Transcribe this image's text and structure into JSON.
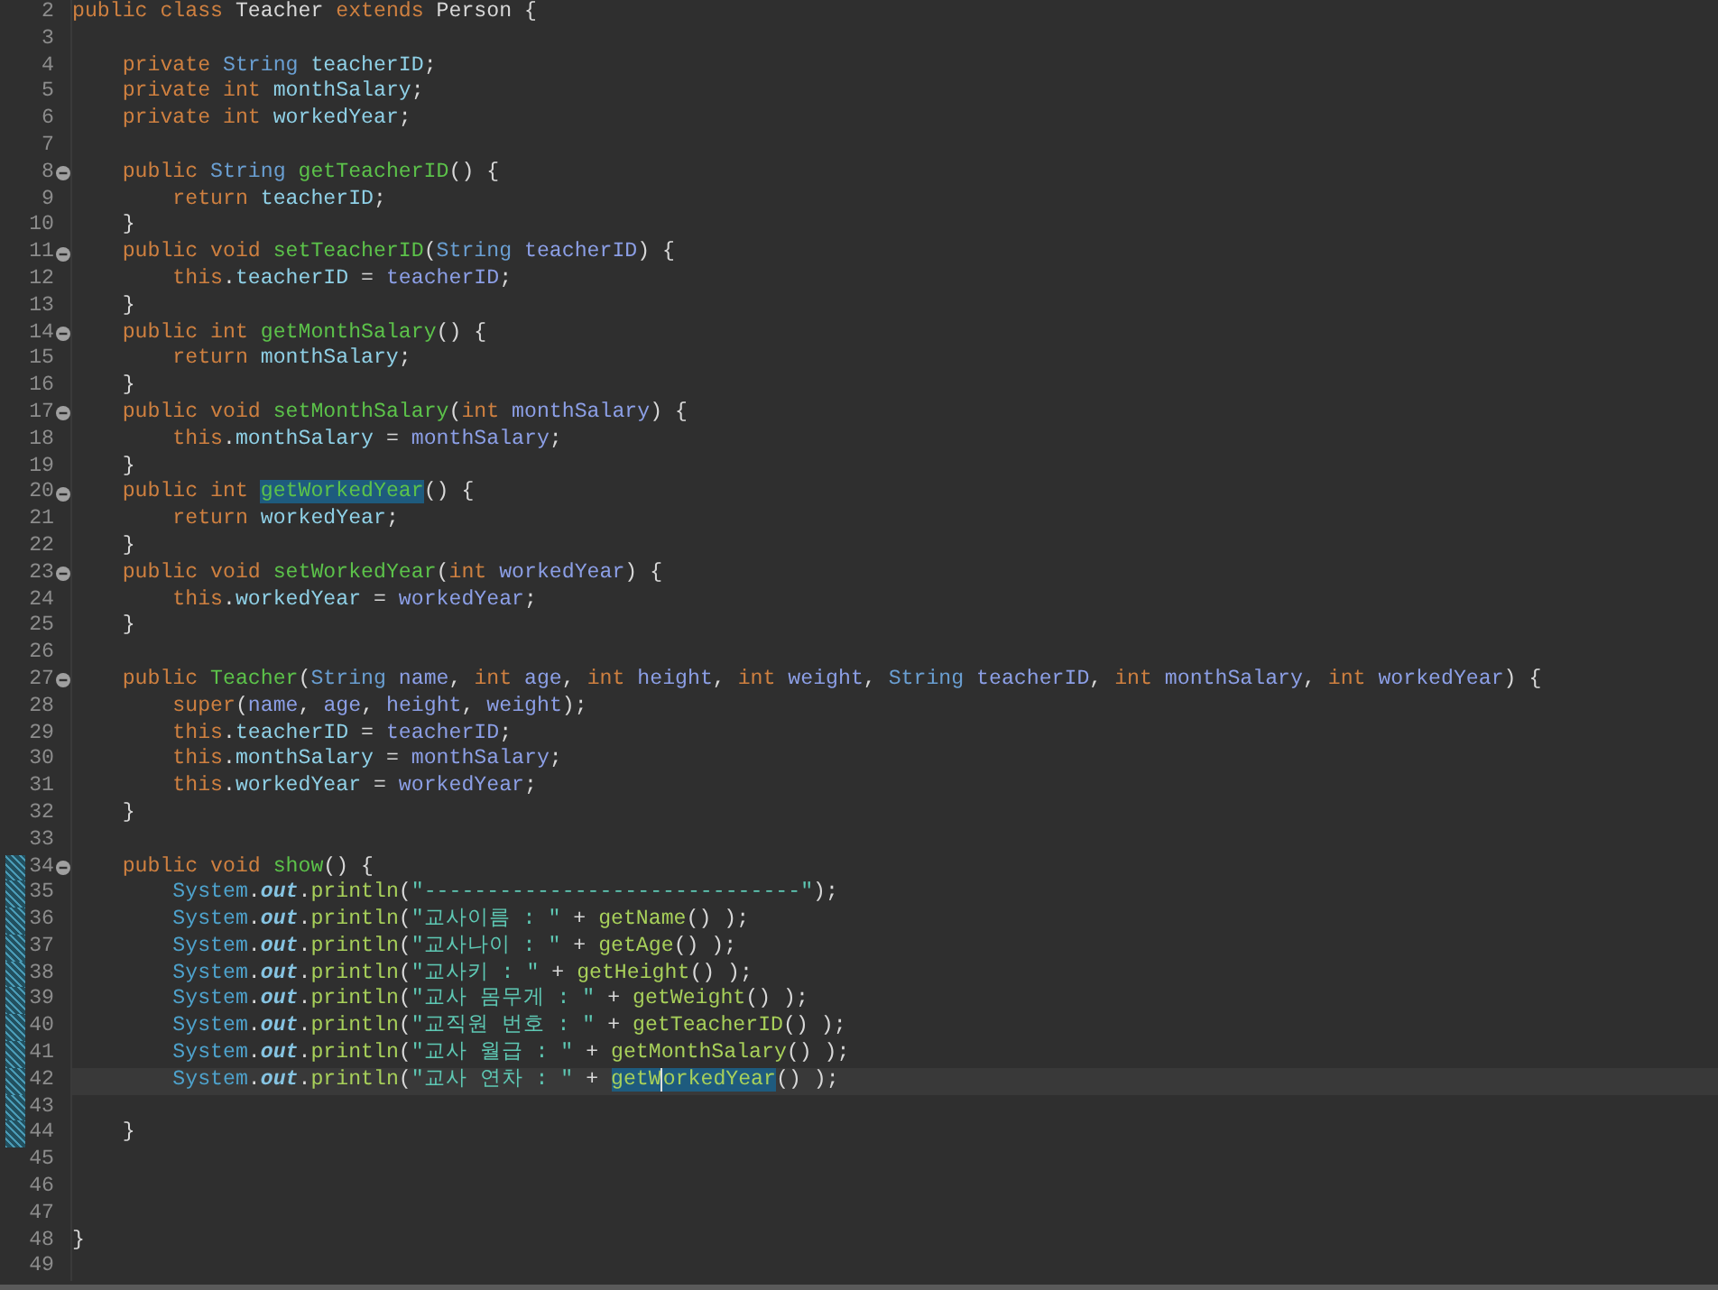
{
  "editor": {
    "lines": [
      {
        "number": "2",
        "fold": false,
        "changed": false,
        "current": false,
        "tokens": [
          {
            "kind": "keyword",
            "text": "public"
          },
          {
            "kind": "keyword",
            "text": " class"
          },
          {
            "kind": "plain",
            "text": " Teacher"
          },
          {
            "kind": "keyword",
            "text": " extends"
          },
          {
            "kind": "plain",
            "text": " Person {"
          }
        ]
      },
      {
        "number": "3",
        "fold": false,
        "changed": false,
        "current": false
      },
      {
        "number": "4",
        "fold": false,
        "changed": false,
        "current": false,
        "tokens": [
          {
            "kind": "keyword",
            "text": "    private"
          },
          {
            "kind": "type",
            "text": " String"
          },
          {
            "kind": "field",
            "text": " teacherID"
          },
          {
            "kind": "plain",
            "text": ";"
          }
        ]
      },
      {
        "number": "5",
        "fold": false,
        "changed": false,
        "current": false,
        "tokens": [
          {
            "kind": "keyword",
            "text": "    private"
          },
          {
            "kind": "keyword",
            "text": " int"
          },
          {
            "kind": "field",
            "text": " monthSalary"
          },
          {
            "kind": "plain",
            "text": ";"
          }
        ]
      },
      {
        "number": "6",
        "fold": false,
        "changed": false,
        "current": false,
        "tokens": [
          {
            "kind": "keyword",
            "text": "    private"
          },
          {
            "kind": "keyword",
            "text": " int"
          },
          {
            "kind": "field",
            "text": " workedYear"
          },
          {
            "kind": "plain",
            "text": ";"
          }
        ]
      },
      {
        "number": "7",
        "fold": false,
        "changed": false,
        "current": false
      },
      {
        "number": "8",
        "fold": true,
        "changed": false,
        "current": false,
        "tokens": [
          {
            "kind": "keyword",
            "text": "    public"
          },
          {
            "kind": "type",
            "text": " String"
          },
          {
            "kind": "method",
            "text": " getTeacherID"
          },
          {
            "kind": "plain",
            "text": "() {"
          }
        ]
      },
      {
        "number": "9",
        "fold": false,
        "changed": false,
        "current": false,
        "tokens": [
          {
            "kind": "keyword",
            "text": "        return"
          },
          {
            "kind": "field",
            "text": " teacherID"
          },
          {
            "kind": "plain",
            "text": ";"
          }
        ]
      },
      {
        "number": "10",
        "fold": false,
        "changed": false,
        "current": false,
        "tokens": [
          {
            "kind": "plain",
            "text": "    }"
          }
        ]
      },
      {
        "number": "11",
        "fold": true,
        "changed": false,
        "current": false,
        "tokens": [
          {
            "kind": "keyword",
            "text": "    public"
          },
          {
            "kind": "keyword",
            "text": " void"
          },
          {
            "kind": "method",
            "text": " setTeacherID"
          },
          {
            "kind": "plain",
            "text": "("
          },
          {
            "kind": "type",
            "text": "String"
          },
          {
            "kind": "param",
            "text": " teacherID"
          },
          {
            "kind": "plain",
            "text": ") {"
          }
        ]
      },
      {
        "number": "12",
        "fold": false,
        "changed": false,
        "current": false,
        "tokens": [
          {
            "kind": "keyword",
            "text": "        this"
          },
          {
            "kind": "plain",
            "text": "."
          },
          {
            "kind": "field",
            "text": "teacherID"
          },
          {
            "kind": "plain",
            "text": " = "
          },
          {
            "kind": "param",
            "text": "teacherID"
          },
          {
            "kind": "plain",
            "text": ";"
          }
        ]
      },
      {
        "number": "13",
        "fold": false,
        "changed": false,
        "current": false,
        "tokens": [
          {
            "kind": "plain",
            "text": "    }"
          }
        ]
      },
      {
        "number": "14",
        "fold": true,
        "changed": false,
        "current": false,
        "tokens": [
          {
            "kind": "keyword",
            "text": "    public"
          },
          {
            "kind": "keyword",
            "text": " int"
          },
          {
            "kind": "method",
            "text": " getMonthSalary"
          },
          {
            "kind": "plain",
            "text": "() {"
          }
        ]
      },
      {
        "number": "15",
        "fold": false,
        "changed": false,
        "current": false,
        "tokens": [
          {
            "kind": "keyword",
            "text": "        return"
          },
          {
            "kind": "field",
            "text": " monthSalary"
          },
          {
            "kind": "plain",
            "text": ";"
          }
        ]
      },
      {
        "number": "16",
        "fold": false,
        "changed": false,
        "current": false,
        "tokens": [
          {
            "kind": "plain",
            "text": "    }"
          }
        ]
      },
      {
        "number": "17",
        "fold": true,
        "changed": false,
        "current": false,
        "tokens": [
          {
            "kind": "keyword",
            "text": "    public"
          },
          {
            "kind": "keyword",
            "text": " void"
          },
          {
            "kind": "method",
            "text": " setMonthSalary"
          },
          {
            "kind": "plain",
            "text": "("
          },
          {
            "kind": "keyword",
            "text": "int"
          },
          {
            "kind": "param",
            "text": " monthSalary"
          },
          {
            "kind": "plain",
            "text": ") {"
          }
        ]
      },
      {
        "number": "18",
        "fold": false,
        "changed": false,
        "current": false,
        "tokens": [
          {
            "kind": "keyword",
            "text": "        this"
          },
          {
            "kind": "plain",
            "text": "."
          },
          {
            "kind": "field",
            "text": "monthSalary"
          },
          {
            "kind": "plain",
            "text": " = "
          },
          {
            "kind": "param",
            "text": "monthSalary"
          },
          {
            "kind": "plain",
            "text": ";"
          }
        ]
      },
      {
        "number": "19",
        "fold": false,
        "changed": false,
        "current": false,
        "tokens": [
          {
            "kind": "plain",
            "text": "    }"
          }
        ]
      },
      {
        "number": "20",
        "fold": true,
        "changed": false,
        "current": false,
        "tokens": [
          {
            "kind": "keyword",
            "text": "    public"
          },
          {
            "kind": "keyword",
            "text": " int "
          },
          {
            "kind": "method",
            "text": "getWorkedYear",
            "highlight": true
          },
          {
            "kind": "plain",
            "text": "() {"
          }
        ]
      },
      {
        "number": "21",
        "fold": false,
        "changed": false,
        "current": false,
        "tokens": [
          {
            "kind": "keyword",
            "text": "        return"
          },
          {
            "kind": "field",
            "text": " workedYear"
          },
          {
            "kind": "plain",
            "text": ";"
          }
        ]
      },
      {
        "number": "22",
        "fold": false,
        "changed": false,
        "current": false,
        "tokens": [
          {
            "kind": "plain",
            "text": "    }"
          }
        ]
      },
      {
        "number": "23",
        "fold": true,
        "changed": false,
        "current": false,
        "tokens": [
          {
            "kind": "keyword",
            "text": "    public"
          },
          {
            "kind": "keyword",
            "text": " void"
          },
          {
            "kind": "method",
            "text": " setWorkedYear"
          },
          {
            "kind": "plain",
            "text": "("
          },
          {
            "kind": "keyword",
            "text": "int"
          },
          {
            "kind": "param",
            "text": " workedYear"
          },
          {
            "kind": "plain",
            "text": ") {"
          }
        ]
      },
      {
        "number": "24",
        "fold": false,
        "changed": false,
        "current": false,
        "tokens": [
          {
            "kind": "keyword",
            "text": "        this"
          },
          {
            "kind": "plain",
            "text": "."
          },
          {
            "kind": "field",
            "text": "workedYear"
          },
          {
            "kind": "plain",
            "text": " = "
          },
          {
            "kind": "param",
            "text": "workedYear"
          },
          {
            "kind": "plain",
            "text": ";"
          }
        ]
      },
      {
        "number": "25",
        "fold": false,
        "changed": false,
        "current": false,
        "tokens": [
          {
            "kind": "plain",
            "text": "    }"
          }
        ]
      },
      {
        "number": "26",
        "fold": false,
        "changed": false,
        "current": false
      },
      {
        "number": "27",
        "fold": true,
        "changed": false,
        "current": false,
        "tokens": [
          {
            "kind": "keyword",
            "text": "    public"
          },
          {
            "kind": "method",
            "text": " Teacher"
          },
          {
            "kind": "plain",
            "text": "("
          },
          {
            "kind": "type",
            "text": "String"
          },
          {
            "kind": "param",
            "text": " name"
          },
          {
            "kind": "plain",
            "text": ", "
          },
          {
            "kind": "keyword",
            "text": "int"
          },
          {
            "kind": "param",
            "text": " age"
          },
          {
            "kind": "plain",
            "text": ", "
          },
          {
            "kind": "keyword",
            "text": "int"
          },
          {
            "kind": "param",
            "text": " height"
          },
          {
            "kind": "plain",
            "text": ", "
          },
          {
            "kind": "keyword",
            "text": "int"
          },
          {
            "kind": "param",
            "text": " weight"
          },
          {
            "kind": "plain",
            "text": ", "
          },
          {
            "kind": "type",
            "text": "String"
          },
          {
            "kind": "param",
            "text": " teacherID"
          },
          {
            "kind": "plain",
            "text": ", "
          },
          {
            "kind": "keyword",
            "text": "int"
          },
          {
            "kind": "param",
            "text": " monthSalary"
          },
          {
            "kind": "plain",
            "text": ", "
          },
          {
            "kind": "keyword",
            "text": "int"
          },
          {
            "kind": "param",
            "text": " workedYear"
          },
          {
            "kind": "plain",
            "text": ") {"
          }
        ]
      },
      {
        "number": "28",
        "fold": false,
        "changed": false,
        "current": false,
        "tokens": [
          {
            "kind": "keyword",
            "text": "        super"
          },
          {
            "kind": "plain",
            "text": "("
          },
          {
            "kind": "param",
            "text": "name"
          },
          {
            "kind": "plain",
            "text": ", "
          },
          {
            "kind": "param",
            "text": "age"
          },
          {
            "kind": "plain",
            "text": ", "
          },
          {
            "kind": "param",
            "text": "height"
          },
          {
            "kind": "plain",
            "text": ", "
          },
          {
            "kind": "param",
            "text": "weight"
          },
          {
            "kind": "plain",
            "text": ");"
          }
        ]
      },
      {
        "number": "29",
        "fold": false,
        "changed": false,
        "current": false,
        "tokens": [
          {
            "kind": "keyword",
            "text": "        this"
          },
          {
            "kind": "plain",
            "text": "."
          },
          {
            "kind": "field",
            "text": "teacherID"
          },
          {
            "kind": "plain",
            "text": " = "
          },
          {
            "kind": "param",
            "text": "teacherID"
          },
          {
            "kind": "plain",
            "text": ";"
          }
        ]
      },
      {
        "number": "30",
        "fold": false,
        "changed": false,
        "current": false,
        "tokens": [
          {
            "kind": "keyword",
            "text": "        this"
          },
          {
            "kind": "plain",
            "text": "."
          },
          {
            "kind": "field",
            "text": "monthSalary"
          },
          {
            "kind": "plain",
            "text": " = "
          },
          {
            "kind": "param",
            "text": "monthSalary"
          },
          {
            "kind": "plain",
            "text": ";"
          }
        ]
      },
      {
        "number": "31",
        "fold": false,
        "changed": false,
        "current": false,
        "tokens": [
          {
            "kind": "keyword",
            "text": "        this"
          },
          {
            "kind": "plain",
            "text": "."
          },
          {
            "kind": "field",
            "text": "workedYear"
          },
          {
            "kind": "plain",
            "text": " = "
          },
          {
            "kind": "param",
            "text": "workedYear"
          },
          {
            "kind": "plain",
            "text": ";"
          }
        ]
      },
      {
        "number": "32",
        "fold": false,
        "changed": false,
        "current": false,
        "tokens": [
          {
            "kind": "plain",
            "text": "    }"
          }
        ]
      },
      {
        "number": "33",
        "fold": false,
        "changed": false,
        "current": false
      },
      {
        "number": "34",
        "fold": true,
        "changed": true,
        "current": false,
        "tokens": [
          {
            "kind": "keyword",
            "text": "    public"
          },
          {
            "kind": "keyword",
            "text": " void"
          },
          {
            "kind": "method",
            "text": " show"
          },
          {
            "kind": "plain",
            "text": "() {"
          }
        ]
      },
      {
        "number": "35",
        "fold": false,
        "changed": true,
        "current": false,
        "tokens": [
          {
            "kind": "class",
            "text": "        System"
          },
          {
            "kind": "plain",
            "text": "."
          },
          {
            "kind": "static",
            "text": "out"
          },
          {
            "kind": "plain",
            "text": "."
          },
          {
            "kind": "call",
            "text": "println"
          },
          {
            "kind": "plain",
            "text": "("
          },
          {
            "kind": "string",
            "text": "\"------------------------------\""
          },
          {
            "kind": "plain",
            "text": ");"
          }
        ]
      },
      {
        "number": "36",
        "fold": false,
        "changed": true,
        "current": false,
        "tokens": [
          {
            "kind": "class",
            "text": "        System"
          },
          {
            "kind": "plain",
            "text": "."
          },
          {
            "kind": "static",
            "text": "out"
          },
          {
            "kind": "plain",
            "text": "."
          },
          {
            "kind": "call",
            "text": "println"
          },
          {
            "kind": "plain",
            "text": "("
          },
          {
            "kind": "string",
            "text": "\"교사이름 : \""
          },
          {
            "kind": "plain",
            "text": " + "
          },
          {
            "kind": "call",
            "text": "getName"
          },
          {
            "kind": "plain",
            "text": "() );"
          }
        ]
      },
      {
        "number": "37",
        "fold": false,
        "changed": true,
        "current": false,
        "tokens": [
          {
            "kind": "class",
            "text": "        System"
          },
          {
            "kind": "plain",
            "text": "."
          },
          {
            "kind": "static",
            "text": "out"
          },
          {
            "kind": "plain",
            "text": "."
          },
          {
            "kind": "call",
            "text": "println"
          },
          {
            "kind": "plain",
            "text": "("
          },
          {
            "kind": "string",
            "text": "\"교사나이 : \""
          },
          {
            "kind": "plain",
            "text": " + "
          },
          {
            "kind": "call",
            "text": "getAge"
          },
          {
            "kind": "plain",
            "text": "() );"
          }
        ]
      },
      {
        "number": "38",
        "fold": false,
        "changed": true,
        "current": false,
        "tokens": [
          {
            "kind": "class",
            "text": "        System"
          },
          {
            "kind": "plain",
            "text": "."
          },
          {
            "kind": "static",
            "text": "out"
          },
          {
            "kind": "plain",
            "text": "."
          },
          {
            "kind": "call",
            "text": "println"
          },
          {
            "kind": "plain",
            "text": "("
          },
          {
            "kind": "string",
            "text": "\"교사키 : \""
          },
          {
            "kind": "plain",
            "text": " + "
          },
          {
            "kind": "call",
            "text": "getHeight"
          },
          {
            "kind": "plain",
            "text": "() );"
          }
        ]
      },
      {
        "number": "39",
        "fold": false,
        "changed": true,
        "current": false,
        "tokens": [
          {
            "kind": "class",
            "text": "        System"
          },
          {
            "kind": "plain",
            "text": "."
          },
          {
            "kind": "static",
            "text": "out"
          },
          {
            "kind": "plain",
            "text": "."
          },
          {
            "kind": "call",
            "text": "println"
          },
          {
            "kind": "plain",
            "text": "("
          },
          {
            "kind": "string",
            "text": "\"교사 몸무게 : \""
          },
          {
            "kind": "plain",
            "text": " + "
          },
          {
            "kind": "call",
            "text": "getWeight"
          },
          {
            "kind": "plain",
            "text": "() );"
          }
        ]
      },
      {
        "number": "40",
        "fold": false,
        "changed": true,
        "current": false,
        "tokens": [
          {
            "kind": "class",
            "text": "        System"
          },
          {
            "kind": "plain",
            "text": "."
          },
          {
            "kind": "static",
            "text": "out"
          },
          {
            "kind": "plain",
            "text": "."
          },
          {
            "kind": "call",
            "text": "println"
          },
          {
            "kind": "plain",
            "text": "("
          },
          {
            "kind": "string",
            "text": "\"교직원 번호 : \""
          },
          {
            "kind": "plain",
            "text": " + "
          },
          {
            "kind": "call",
            "text": "getTeacherID"
          },
          {
            "kind": "plain",
            "text": "() );"
          }
        ]
      },
      {
        "number": "41",
        "fold": false,
        "changed": true,
        "current": false,
        "tokens": [
          {
            "kind": "class",
            "text": "        System"
          },
          {
            "kind": "plain",
            "text": "."
          },
          {
            "kind": "static",
            "text": "out"
          },
          {
            "kind": "plain",
            "text": "."
          },
          {
            "kind": "call",
            "text": "println"
          },
          {
            "kind": "plain",
            "text": "("
          },
          {
            "kind": "string",
            "text": "\"교사 월급 : \""
          },
          {
            "kind": "plain",
            "text": " + "
          },
          {
            "kind": "call",
            "text": "getMonthSalary"
          },
          {
            "kind": "plain",
            "text": "() );"
          }
        ]
      },
      {
        "number": "42",
        "fold": false,
        "changed": true,
        "current": true,
        "tokens": [
          {
            "kind": "class",
            "text": "        System"
          },
          {
            "kind": "plain",
            "text": "."
          },
          {
            "kind": "static",
            "text": "out"
          },
          {
            "kind": "plain",
            "text": "."
          },
          {
            "kind": "call",
            "text": "println"
          },
          {
            "kind": "plain",
            "text": "("
          },
          {
            "kind": "string",
            "text": "\"교사 연차 : \""
          },
          {
            "kind": "plain",
            "text": " + "
          },
          {
            "kind": "call",
            "text": "getW",
            "highlight": true
          },
          {
            "kind": "call",
            "text": "orkedYear",
            "highlight": true,
            "caret": true
          },
          {
            "kind": "plain",
            "text": "() );"
          }
        ]
      },
      {
        "number": "43",
        "fold": false,
        "changed": true,
        "current": false
      },
      {
        "number": "44",
        "fold": false,
        "changed": true,
        "current": false,
        "tokens": [
          {
            "kind": "plain",
            "text": "    }"
          }
        ]
      },
      {
        "number": "45",
        "fold": false,
        "changed": false,
        "current": false
      },
      {
        "number": "46",
        "fold": false,
        "changed": false,
        "current": false
      },
      {
        "number": "47",
        "fold": false,
        "changed": false,
        "current": false
      },
      {
        "number": "48",
        "fold": false,
        "changed": false,
        "current": false,
        "tokens": [
          {
            "kind": "plain",
            "text": "}"
          }
        ]
      },
      {
        "number": "49",
        "fold": false,
        "changed": false,
        "current": false
      }
    ]
  }
}
